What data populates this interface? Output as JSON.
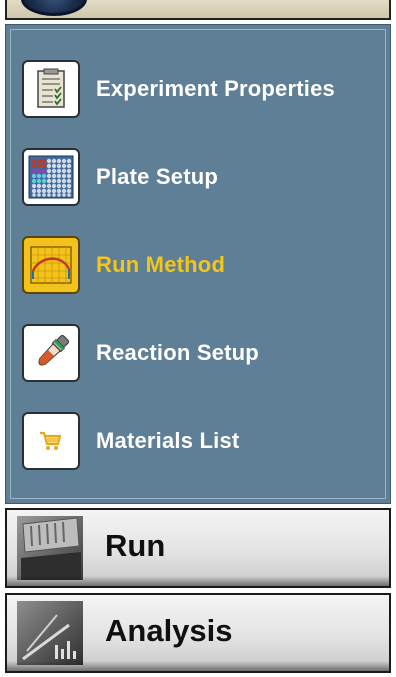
{
  "setup_panel": {
    "items": [
      {
        "label": "Experiment Properties",
        "icon": "clipboard-checklist-icon",
        "active": false
      },
      {
        "label": "Plate Setup",
        "icon": "plate-grid-icon",
        "active": false
      },
      {
        "label": "Run Method",
        "icon": "thermal-profile-icon",
        "active": true
      },
      {
        "label": "Reaction Setup",
        "icon": "pipette-tube-icon",
        "active": false
      },
      {
        "label": "Materials List",
        "icon": "shopping-cart-icon",
        "active": false
      }
    ]
  },
  "sections": {
    "run_label": "Run",
    "analysis_label": "Analysis"
  },
  "colors": {
    "panel_background": "#5e7f95",
    "active_text": "#f5c518",
    "active_icon_background": "#f3c21c"
  }
}
